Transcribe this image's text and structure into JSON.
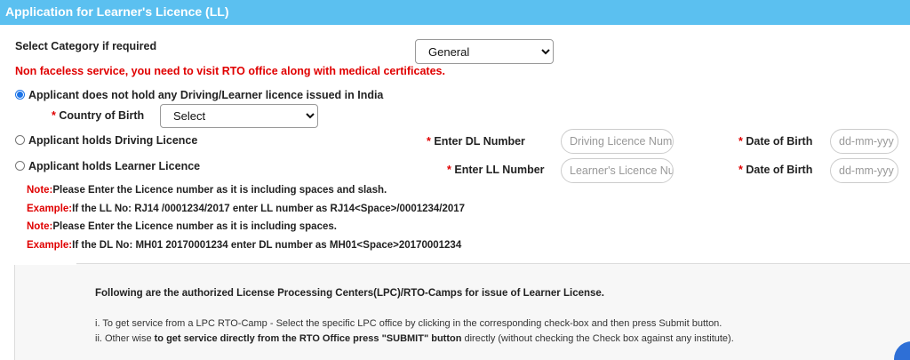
{
  "header": {
    "title": "Application for Learner's Licence (LL)"
  },
  "category": {
    "label": "Select Category if required",
    "selected": "General"
  },
  "warning": "Non faceless service, you need to visit RTO office along with medical certificates.",
  "options": {
    "no_licence": "Applicant does not hold any Driving/Learner licence issued in India",
    "driving_licence": "Applicant holds Driving Licence",
    "learner_licence": "Applicant holds Learner Licence"
  },
  "country": {
    "required_mark": "*",
    "label": "Country of Birth",
    "selected": "Select"
  },
  "dl": {
    "required_mark": "*",
    "label": "Enter DL Number",
    "placeholder": "Driving Licence Num",
    "dob_label": "Date of Birth",
    "dob_placeholder": "dd-mm-yyy"
  },
  "ll": {
    "required_mark": "*",
    "label": "Enter LL Number",
    "placeholder": "Learner's Licence Nu",
    "dob_label": "Date of Birth",
    "dob_placeholder": "dd-mm-yyy"
  },
  "notes": [
    {
      "prefix": "Note:",
      "text": "Please Enter the Licence number as it is including spaces and slash."
    },
    {
      "prefix": "Example:",
      "text": "If the LL No: RJ14 /0001234/2017 enter LL number as RJ14<Space>/0001234/2017"
    },
    {
      "prefix": "Note:",
      "text": "Please Enter the Licence number as it is including spaces."
    },
    {
      "prefix": "Example:",
      "text": "If the DL No: MH01 20170001234 enter DL number as MH01<Space>20170001234"
    }
  ],
  "lpc_panel": {
    "title": "Following are the authorized License Processing Centers(LPC)/RTO-Camps for issue of Learner License.",
    "line1": "i. To get service from a LPC RTO-Camp - Select the specific LPC office by clicking in the corresponding check-box and then press Submit button.",
    "line2_pre": "ii. Other wise ",
    "line2_bold": "to get service directly from the RTO Office press \"SUBMIT\" button",
    "line2_post": " directly (without checking the Check box against any institute)."
  },
  "colors": {
    "header_bg": "#5bc0f0",
    "warning": "#e00000",
    "accent": "#1a73e8"
  }
}
